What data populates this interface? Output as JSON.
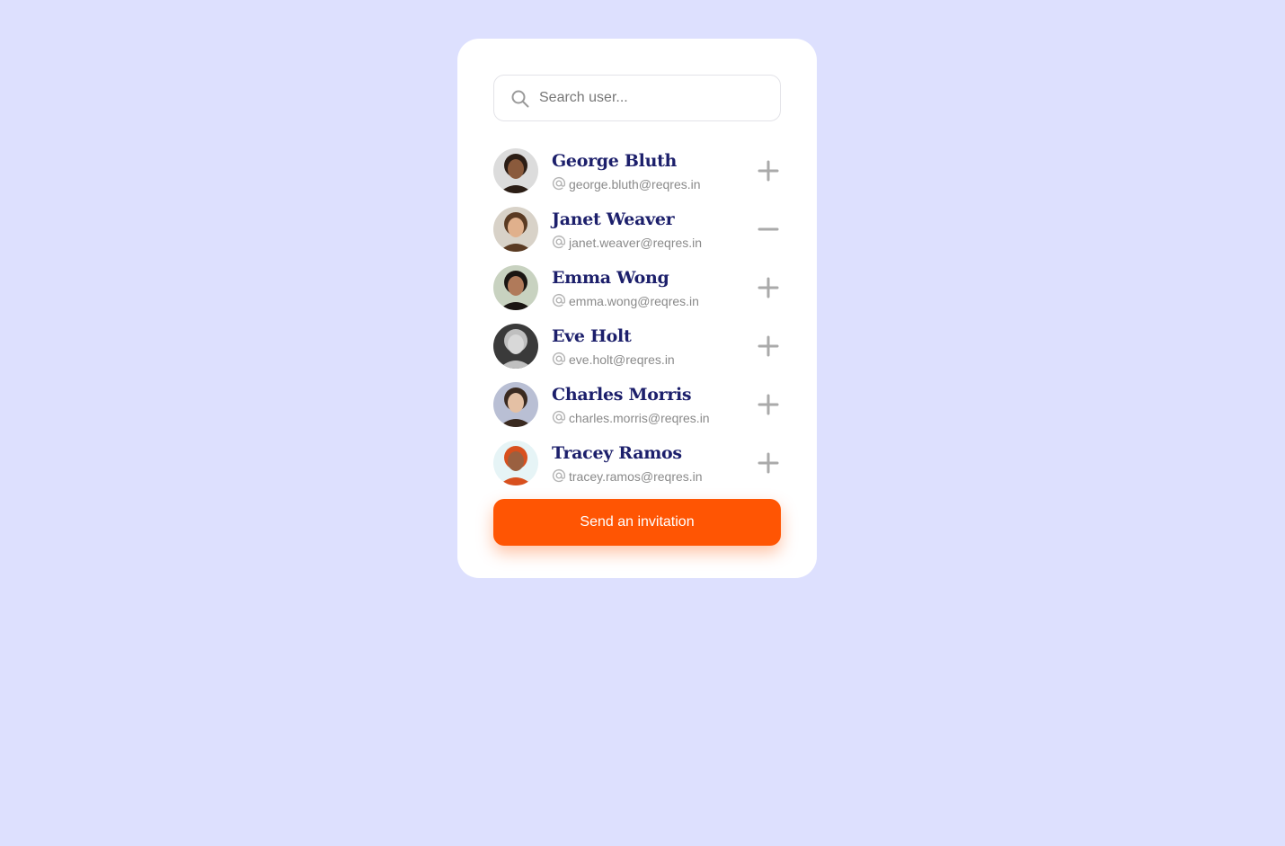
{
  "search": {
    "placeholder": "Search user...",
    "icon": "search-icon"
  },
  "users": [
    {
      "name": "George Bluth",
      "email": "george.bluth@reqres.in",
      "action": "add",
      "action_icon": "plus-icon",
      "avatar_bg": "#dcdcdc",
      "skin": "#8a5a3c",
      "hair": "#2b1d15"
    },
    {
      "name": "Janet Weaver",
      "email": "janet.weaver@reqres.in",
      "action": "remove",
      "action_icon": "minus-icon",
      "avatar_bg": "#d8d2c8",
      "skin": "#e0b08c",
      "hair": "#5a3a22"
    },
    {
      "name": "Emma Wong",
      "email": "emma.wong@reqres.in",
      "action": "add",
      "action_icon": "plus-icon",
      "avatar_bg": "#c8d2c0",
      "skin": "#b07a5a",
      "hair": "#1a1512"
    },
    {
      "name": "Eve Holt",
      "email": "eve.holt@reqres.in",
      "action": "add",
      "action_icon": "plus-icon",
      "avatar_bg": "#3a3a3a",
      "skin": "#d8d8d8",
      "hair": "#bfbfbf"
    },
    {
      "name": "Charles Morris",
      "email": "charles.morris@reqres.in",
      "action": "add",
      "action_icon": "plus-icon",
      "avatar_bg": "#b9bfd4",
      "skin": "#e4c0a4",
      "hair": "#3a2a20"
    },
    {
      "name": "Tracey Ramos",
      "email": "tracey.ramos@reqres.in",
      "action": "add",
      "action_icon": "plus-icon",
      "avatar_bg": "#e6f4f6",
      "skin": "#9a6040",
      "hair": "#d8501e"
    }
  ],
  "send_button": {
    "label": "Send an invitation"
  },
  "colors": {
    "background": "#dde0fe",
    "card": "#ffffff",
    "name_text": "#1c1f6b",
    "email_text": "#8a8a8a",
    "accent": "#ff5503",
    "icon_gray": "#aaaaaa"
  }
}
